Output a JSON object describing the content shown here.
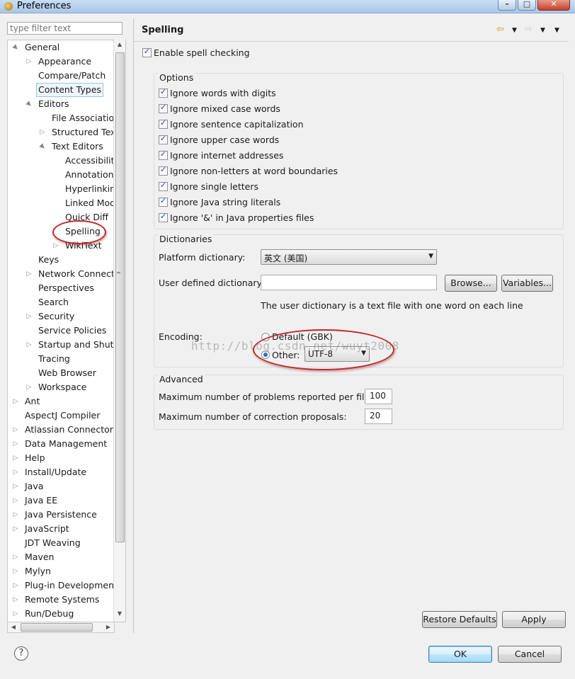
{
  "window": {
    "title": "Preferences"
  },
  "filter": {
    "placeholder": "type filter text"
  },
  "tree": {
    "items": [
      {
        "label": "General",
        "arrow": "▲"
      },
      {
        "label": "Appearance",
        "arrow": "▷"
      },
      {
        "label": "Compare/Patch",
        "arrow": ""
      },
      {
        "label": "Content Types",
        "arrow": ""
      },
      {
        "label": "Editors",
        "arrow": "▲"
      },
      {
        "label": "File Associatio",
        "arrow": ""
      },
      {
        "label": "Structured Text",
        "arrow": "▷"
      },
      {
        "label": "Text Editors",
        "arrow": "▲"
      },
      {
        "label": "Accessibility",
        "arrow": ""
      },
      {
        "label": "Annotations",
        "arrow": ""
      },
      {
        "label": "Hyperlinking",
        "arrow": ""
      },
      {
        "label": "Linked Mod",
        "arrow": ""
      },
      {
        "label": "Quick Diff",
        "arrow": ""
      },
      {
        "label": "Spelling",
        "arrow": ""
      },
      {
        "label": "WikiText",
        "arrow": "▷"
      },
      {
        "label": "Keys",
        "arrow": ""
      },
      {
        "label": "Network Connecti",
        "arrow": "▷"
      },
      {
        "label": "Perspectives",
        "arrow": ""
      },
      {
        "label": "Search",
        "arrow": ""
      },
      {
        "label": "Security",
        "arrow": "▷"
      },
      {
        "label": "Service Policies",
        "arrow": ""
      },
      {
        "label": "Startup and Shutd",
        "arrow": "▷"
      },
      {
        "label": "Tracing",
        "arrow": ""
      },
      {
        "label": "Web Browser",
        "arrow": ""
      },
      {
        "label": "Workspace",
        "arrow": "▷"
      },
      {
        "label": "Ant",
        "arrow": "▷"
      },
      {
        "label": "AspectJ Compiler",
        "arrow": ""
      },
      {
        "label": "Atlassian Connector",
        "arrow": "▷"
      },
      {
        "label": "Data Management",
        "arrow": "▷"
      },
      {
        "label": "Help",
        "arrow": "▷"
      },
      {
        "label": "Install/Update",
        "arrow": "▷"
      },
      {
        "label": "Java",
        "arrow": "▷"
      },
      {
        "label": "Java EE",
        "arrow": "▷"
      },
      {
        "label": "Java Persistence",
        "arrow": "▷"
      },
      {
        "label": "JavaScript",
        "arrow": "▷"
      },
      {
        "label": "JDT Weaving",
        "arrow": ""
      },
      {
        "label": "Maven",
        "arrow": "▷"
      },
      {
        "label": "Mylyn",
        "arrow": "▷"
      },
      {
        "label": "Plug-in Development",
        "arrow": "▷"
      },
      {
        "label": "Remote Systems",
        "arrow": "▷"
      },
      {
        "label": "Run/Debug",
        "arrow": "▷"
      }
    ]
  },
  "page": {
    "title": "Spelling",
    "enable_spell_checking": "Enable spell checking"
  },
  "options": {
    "title": "Options",
    "items": [
      "Ignore words with digits",
      "Ignore mixed case words",
      "Ignore sentence capitalization",
      "Ignore upper case words",
      "Ignore internet addresses",
      "Ignore non-letters at word boundaries",
      "Ignore single letters",
      "Ignore Java string literals",
      "Ignore '&' in Java properties files"
    ]
  },
  "dictionaries": {
    "title": "Dictionaries",
    "platform_label": "Platform dictionary:",
    "platform_value": "英文 (美国)",
    "user_label": "User defined dictionary:",
    "user_value": "",
    "browse": "Browse...",
    "variables": "Variables...",
    "hint": "The user dictionary is a text file with one word on each line",
    "encoding_label": "Encoding:",
    "default_option": "Default (GBK)",
    "other_option": "Other:",
    "other_value": "UTF-8"
  },
  "advanced": {
    "title": "Advanced",
    "max_problems_label": "Maximum number of problems reported per file:",
    "max_problems_value": "100",
    "max_proposals_label": "Maximum number of correction proposals:",
    "max_proposals_value": "20"
  },
  "buttons": {
    "restore_defaults": "Restore Defaults",
    "apply": "Apply",
    "ok": "OK",
    "cancel": "Cancel"
  },
  "watermark": "http://blog.csdn.net/wuyt2008",
  "colors": {
    "annotation_red": "#c0272d",
    "checkmark": "#2a4a8a"
  }
}
